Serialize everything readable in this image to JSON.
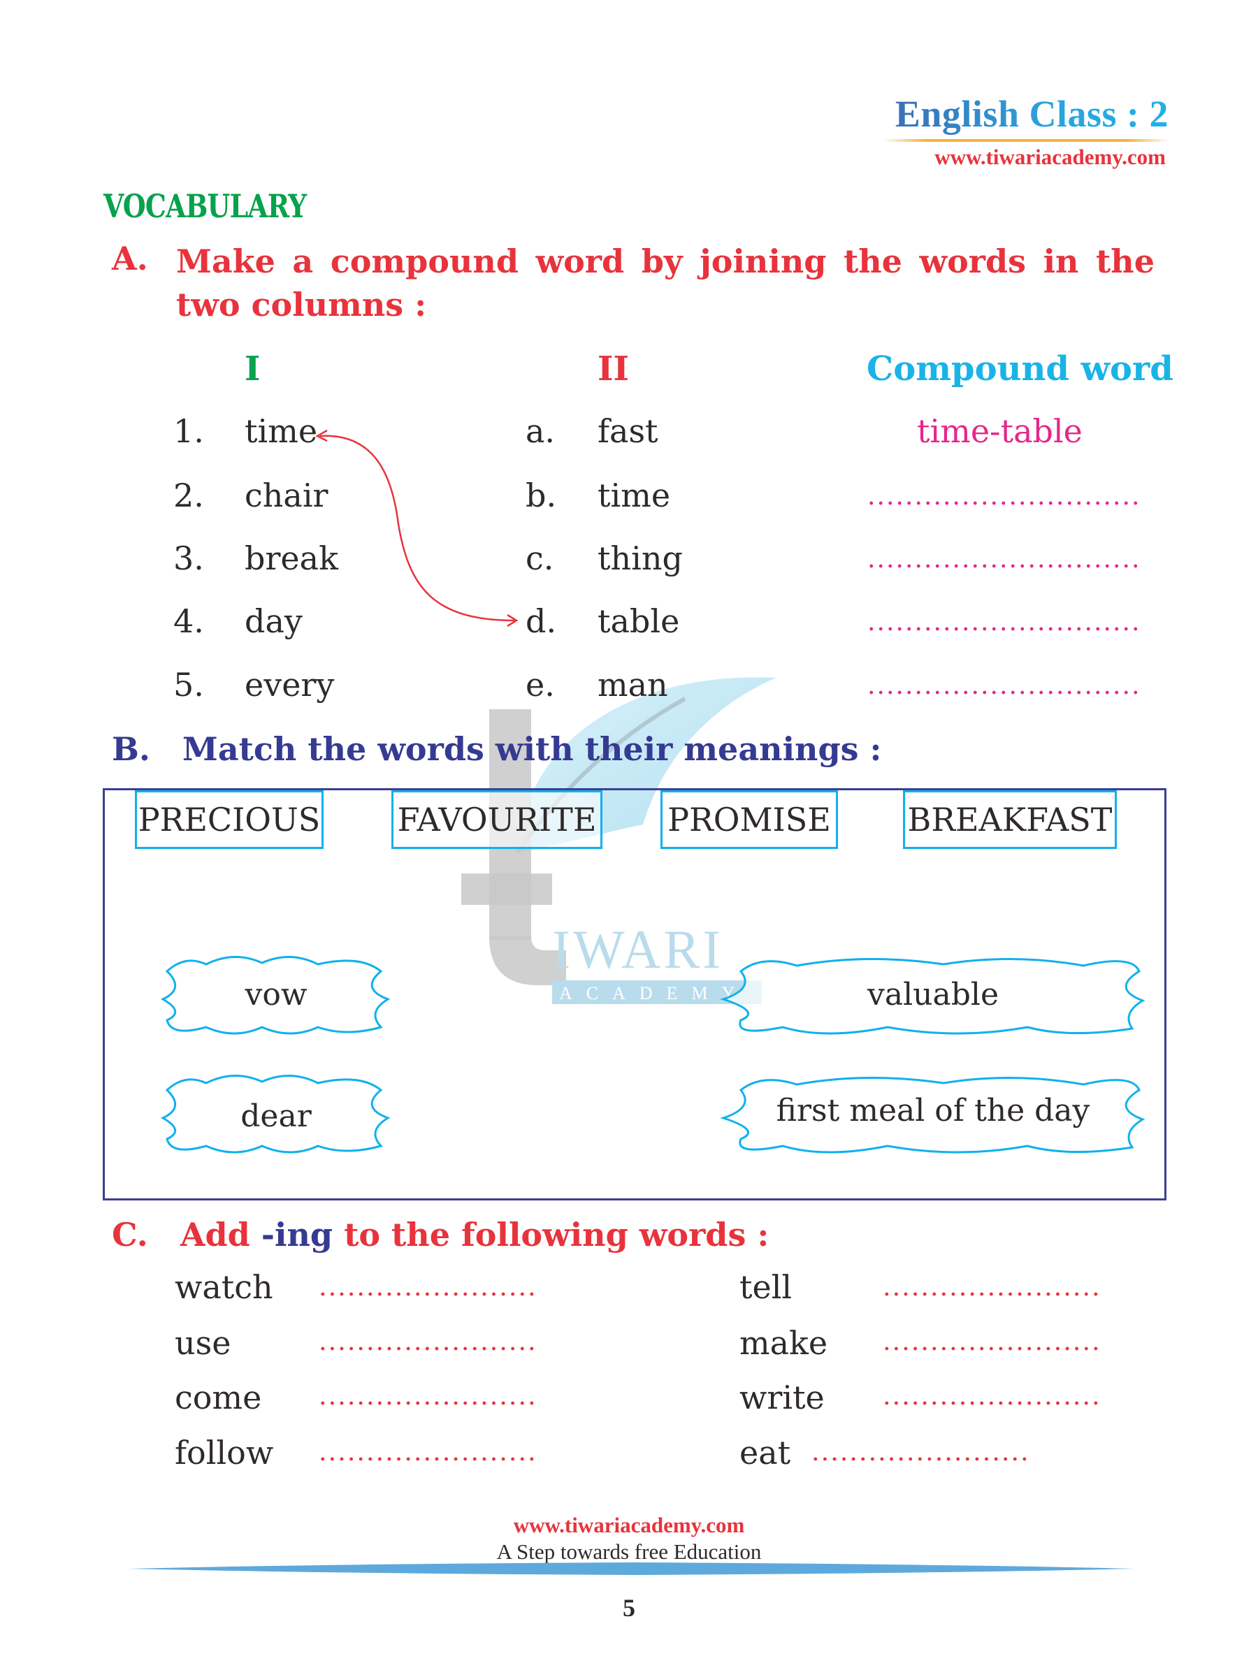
{
  "header": {
    "title": "English Class : 2",
    "website": "www.tiwariacademy.com"
  },
  "watermark": {
    "top_text": "IWARI",
    "bottom_text": "ACADEMY"
  },
  "section_heading": "VOCABULARY",
  "question_a": {
    "letter": "A.",
    "text": "Make a compound word by joining the words in the two columns :",
    "column_headers": [
      "I",
      "II",
      "Compound word"
    ],
    "rows": [
      {
        "num": "1.",
        "word1": "time",
        "letter": "a.",
        "word2": "fast",
        "answer": "time-table"
      },
      {
        "num": "2.",
        "word1": "chair",
        "letter": "b.",
        "word2": "time",
        "answer": ""
      },
      {
        "num": "3.",
        "word1": "break",
        "letter": "c.",
        "word2": "thing",
        "answer": ""
      },
      {
        "num": "4.",
        "word1": "day",
        "letter": "d.",
        "word2": "table",
        "answer": ""
      },
      {
        "num": "5.",
        "word1": "every",
        "letter": "e.",
        "word2": "man",
        "answer": ""
      }
    ],
    "example_arrow": {
      "from": "time",
      "to": "table"
    }
  },
  "question_b": {
    "letter": "B.",
    "text": "Match the words with their meanings :",
    "words": [
      "PRECIOUS",
      "FAVOURITE",
      "PROMISE",
      "BREAKFAST"
    ],
    "meanings": [
      "vow",
      "valuable",
      "dear",
      "first meal of the day"
    ]
  },
  "question_c": {
    "letter": "C.",
    "text_before": "Add ",
    "text_highlight": "-ing",
    "text_after": " to the following words :",
    "left_words": [
      "watch",
      "use",
      "come",
      "follow"
    ],
    "right_words": [
      "tell",
      "make",
      "write",
      "eat"
    ]
  },
  "footer": {
    "website": "www.tiwariacademy.com",
    "tagline": "A Step towards free Education",
    "page_number": "5"
  },
  "colors": {
    "green_heading": "#07a24c",
    "red_heading": "#e8333c",
    "blue_heading": "#353a92",
    "cyan_accent": "#1ab3e8",
    "pink_answer": "#e6268a"
  }
}
